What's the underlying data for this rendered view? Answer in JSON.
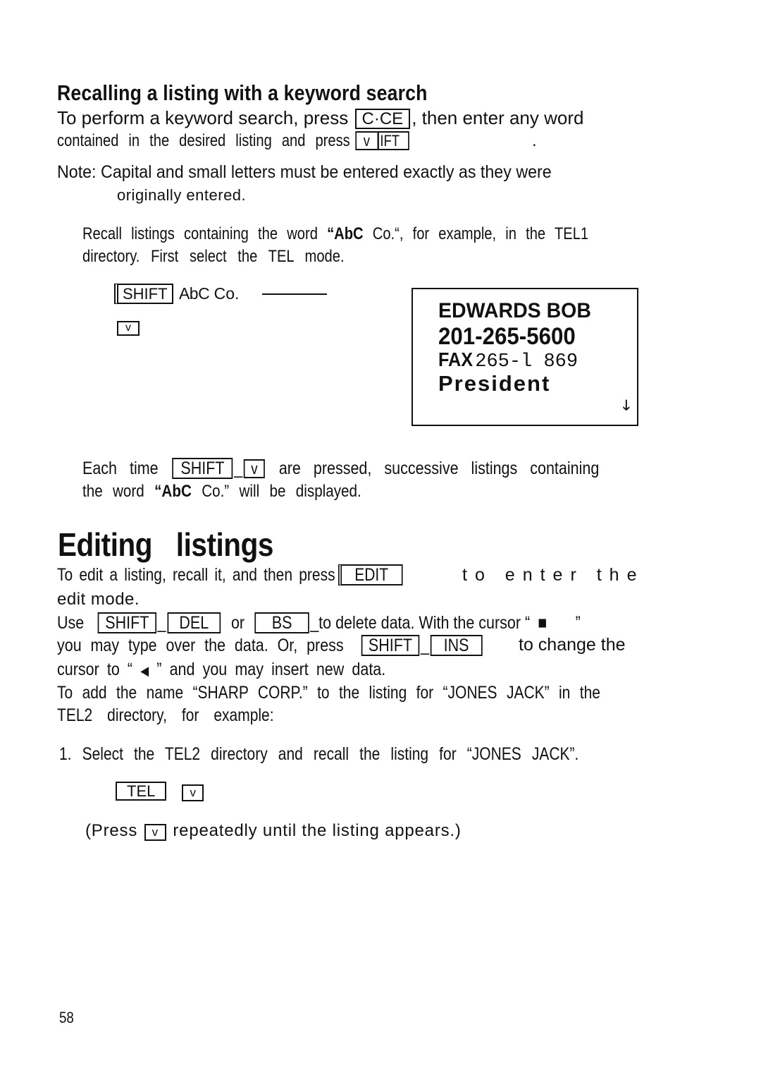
{
  "section_keyword": {
    "heading": "Recalling a listing with a keyword search",
    "p1_a": "To perform a keyword search, press",
    "p1_key": "C·CE",
    "p1_b": ", then enter any word",
    "p2_a": "contained in the desired listing and press",
    "p2_key1": "v",
    "p2_key2": "IFT",
    "p2_end": ".",
    "note_line1": "Note: Capital and small letters must be entered exactly as they were",
    "note_line2": "originally entered.",
    "example_line1_a": "Recall listings containing the word",
    "example_word": "“AbC",
    "example_line1_b": "Co.“, for example, in the TEL1",
    "example_line2": "directory. First select the TEL mode.",
    "steps": {
      "key_shift": "SHIFT",
      "typed_abc": "AbC",
      "typed_co": "Co.",
      "key_down": "v"
    },
    "lcd": {
      "name": "EDWARDS BOB",
      "phone": "201-265-5600",
      "fax_label": "FAX",
      "fax_number": "265-l 869",
      "title": "President",
      "arrow_icon": "down-arrow-icon"
    },
    "each_a": "Each time",
    "each_key1": "SHIFT",
    "each_key2": "v",
    "each_b": "are pressed, successive listings containing",
    "each_line2_a": "the word",
    "each_line2_word": "“AbC",
    "each_line2_b": "Co.” will be displayed."
  },
  "section_editing": {
    "heading": "Editing listings",
    "p1_a": "To edit a listing, recall it, and then press",
    "p1_key": "EDIT",
    "p1_b": "to enter the",
    "p1_line2": "edit mode.",
    "p2_use": "Use",
    "p2_key_shift": "SHIFT",
    "p2_key_del": "DEL",
    "p2_or": "or",
    "p2_key_bs": "BS",
    "p2_b": "to delete data. With the cursor “",
    "p2_cursor_block": "■",
    "p2_close": "”",
    "p3_a": "you may type over the data. Or, press",
    "p3_key_shift": "SHIFT",
    "p3_key_ins": "INS",
    "p3_b": "to change the",
    "p4_a": "cursor to “",
    "p4_cursor_insert": "◀",
    "p4_b": "” and you may insert new data.",
    "p5_line1": "To add the name “SHARP CORP.” to the listing for “JONES JACK” in the",
    "p5_line2": "TEL2 directory, for example:",
    "step1": "1. Select the TEL2 directory and recall the listing for “JONES JACK”.",
    "step1_key_tel": "TEL",
    "step1_key_down": "v",
    "press_a": "(Press",
    "press_key": "v",
    "press_b": "repeatedly until the listing appears.)"
  },
  "page_number": "58"
}
